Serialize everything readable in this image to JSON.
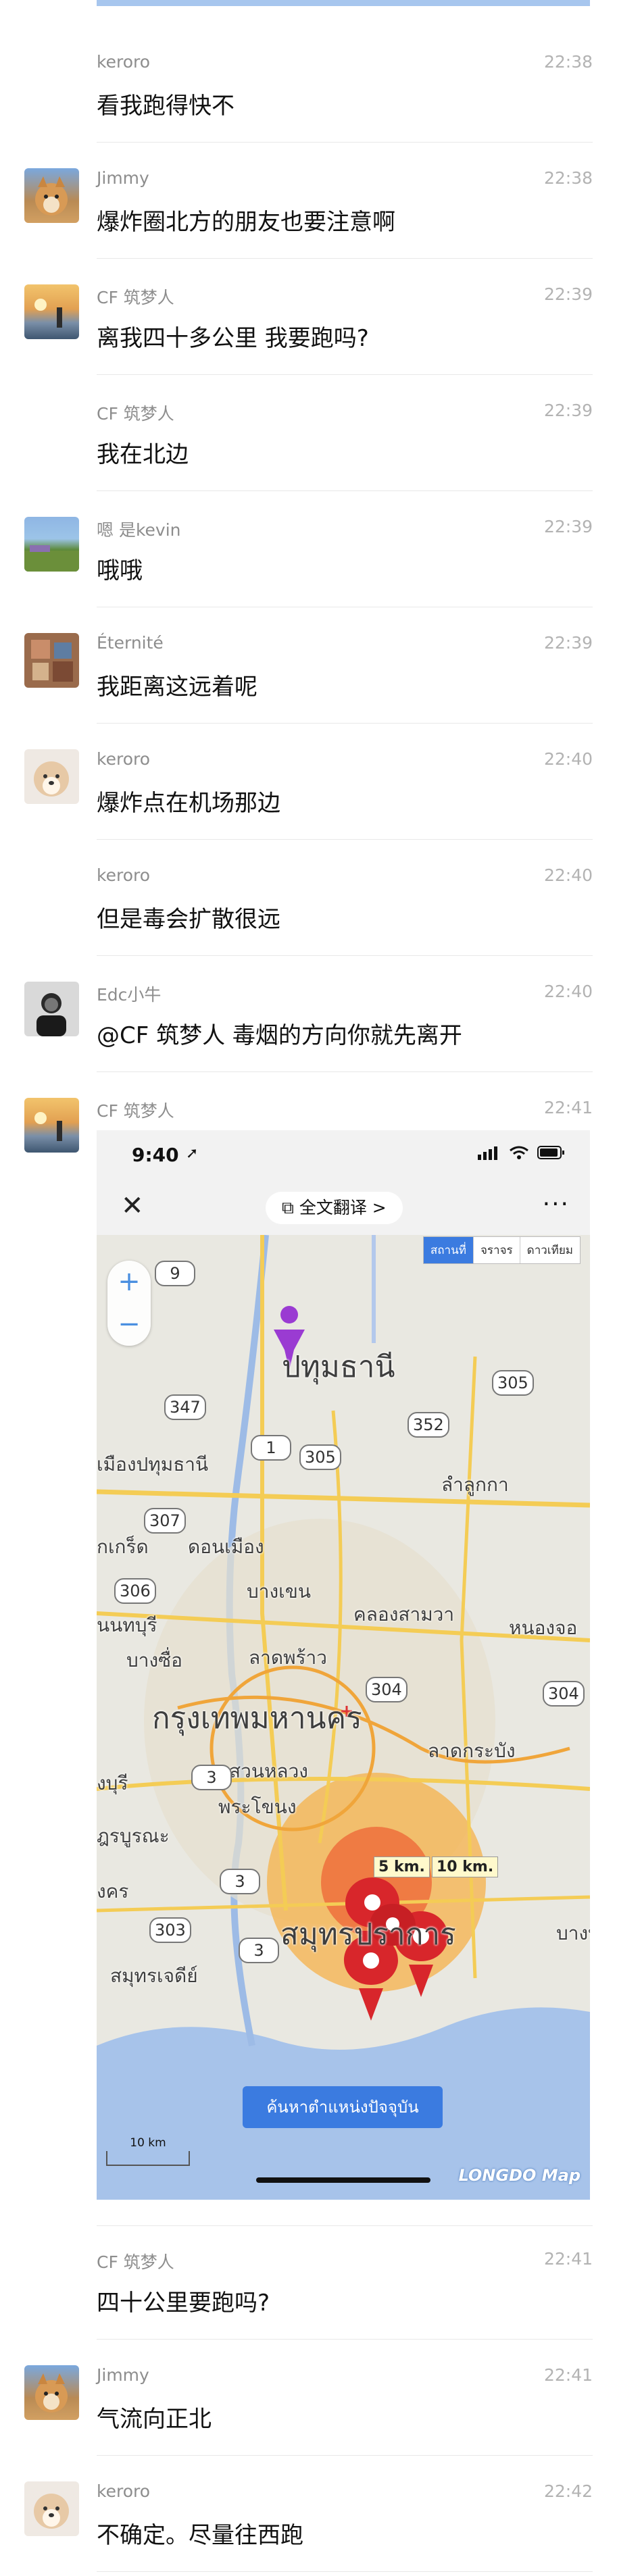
{
  "messages": [
    {
      "name": "keroro",
      "time": "22:38",
      "text": "看我跑得快不"
    },
    {
      "name": "Jimmy",
      "time": "22:38",
      "text": "爆炸圈北方的朋友也要注意啊"
    },
    {
      "name": "CF 筑梦人",
      "time": "22:39",
      "text": "离我四十多公里 我要跑吗?"
    },
    {
      "name": "CF 筑梦人",
      "time": "22:39",
      "text": "我在北边"
    },
    {
      "name": "嗯 是kevin",
      "time": "22:39",
      "text": "哦哦"
    },
    {
      "name": "Éternité",
      "time": "22:39",
      "text": "我距离这远着呢"
    },
    {
      "name": "keroro",
      "time": "22:40",
      "text": "爆炸点在机场那边"
    },
    {
      "name": "keroro",
      "time": "22:40",
      "text": "但是毒会扩散很远"
    },
    {
      "name": "Edc小牛",
      "time": "22:40",
      "text": "@CF 筑梦人 毒烟的方向你就先离开"
    },
    {
      "name": "CF 筑梦人",
      "time": "22:41",
      "text": ""
    },
    {
      "name": "CF 筑梦人",
      "time": "22:41",
      "text": "四十公里要跑吗?"
    },
    {
      "name": "Jimmy",
      "time": "22:41",
      "text": "气流向正北"
    },
    {
      "name": "keroro",
      "time": "22:42",
      "text": "不确定。尽量往西跑"
    }
  ],
  "screenshot": {
    "clock": "9:40",
    "translate_label": "全文翻译 >",
    "map_types": [
      "สถานที่",
      "จราจร",
      "ดาวเทียม"
    ],
    "find_button": "ค้นหาตำแหน่งปัจจุบัน",
    "scale_label": "10 km",
    "brand": "LONGDO Map",
    "distance_labels": [
      "5 km.",
      "10 km."
    ],
    "place_labels": [
      "ปทุมธานี",
      "เมืองปทุมธานี",
      "ลำลูกกา",
      "กเกร็ด",
      "ดอนเมือง",
      "บางเขน",
      "คลองสามวา",
      "หนองจอ",
      "นนทบุรี",
      "บางซื่อ",
      "ลาดพร้าว",
      "กรุงเทพมหานคร",
      "สวนหลวง",
      "ลาดกระบัง",
      "งบุรี",
      "พระโขนง",
      "ฎรบูรณะ",
      "สมุทรปราการ",
      "บางบ่",
      "งคร",
      "สมุทรเจดีย์"
    ],
    "road_numbers": [
      "9",
      "347",
      "1",
      "305",
      "352",
      "305",
      "307",
      "306",
      "304",
      "304",
      "3",
      "3",
      "303",
      "3"
    ]
  }
}
